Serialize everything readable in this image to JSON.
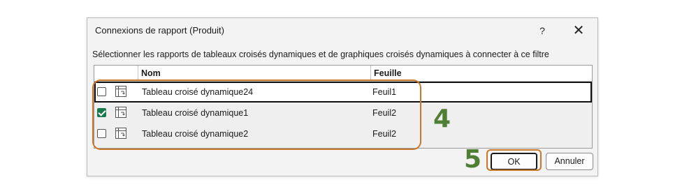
{
  "dialog": {
    "title": "Connexions de rapport (Produit)",
    "help_glyph": "?",
    "close_glyph": "✕",
    "instruction": "Sélectionner les rapports de tableaux croisés dynamiques et de graphiques croisés dynamiques à connecter à ce filtre"
  },
  "grid": {
    "columns": [
      "",
      "Nom",
      "Feuille"
    ],
    "rows": [
      {
        "name": "Tableau croisé dynamique24",
        "sheet": "Feuil1",
        "checked": false,
        "selected": true,
        "icon": "pivot-table-icon"
      },
      {
        "name": "Tableau croisé dynamique1",
        "sheet": "Feuil2",
        "checked": true,
        "selected": false,
        "icon": "pivot-table-icon"
      },
      {
        "name": "Tableau croisé dynamique2",
        "sheet": "Feuil2",
        "checked": false,
        "selected": false,
        "icon": "pivot-table-icon"
      }
    ]
  },
  "buttons": {
    "ok": "OK",
    "cancel": "Annuler"
  },
  "annotations": {
    "step_rows": "4",
    "step_ok": "5",
    "color_box": "#c9782a",
    "color_number": "#4e7f34"
  }
}
